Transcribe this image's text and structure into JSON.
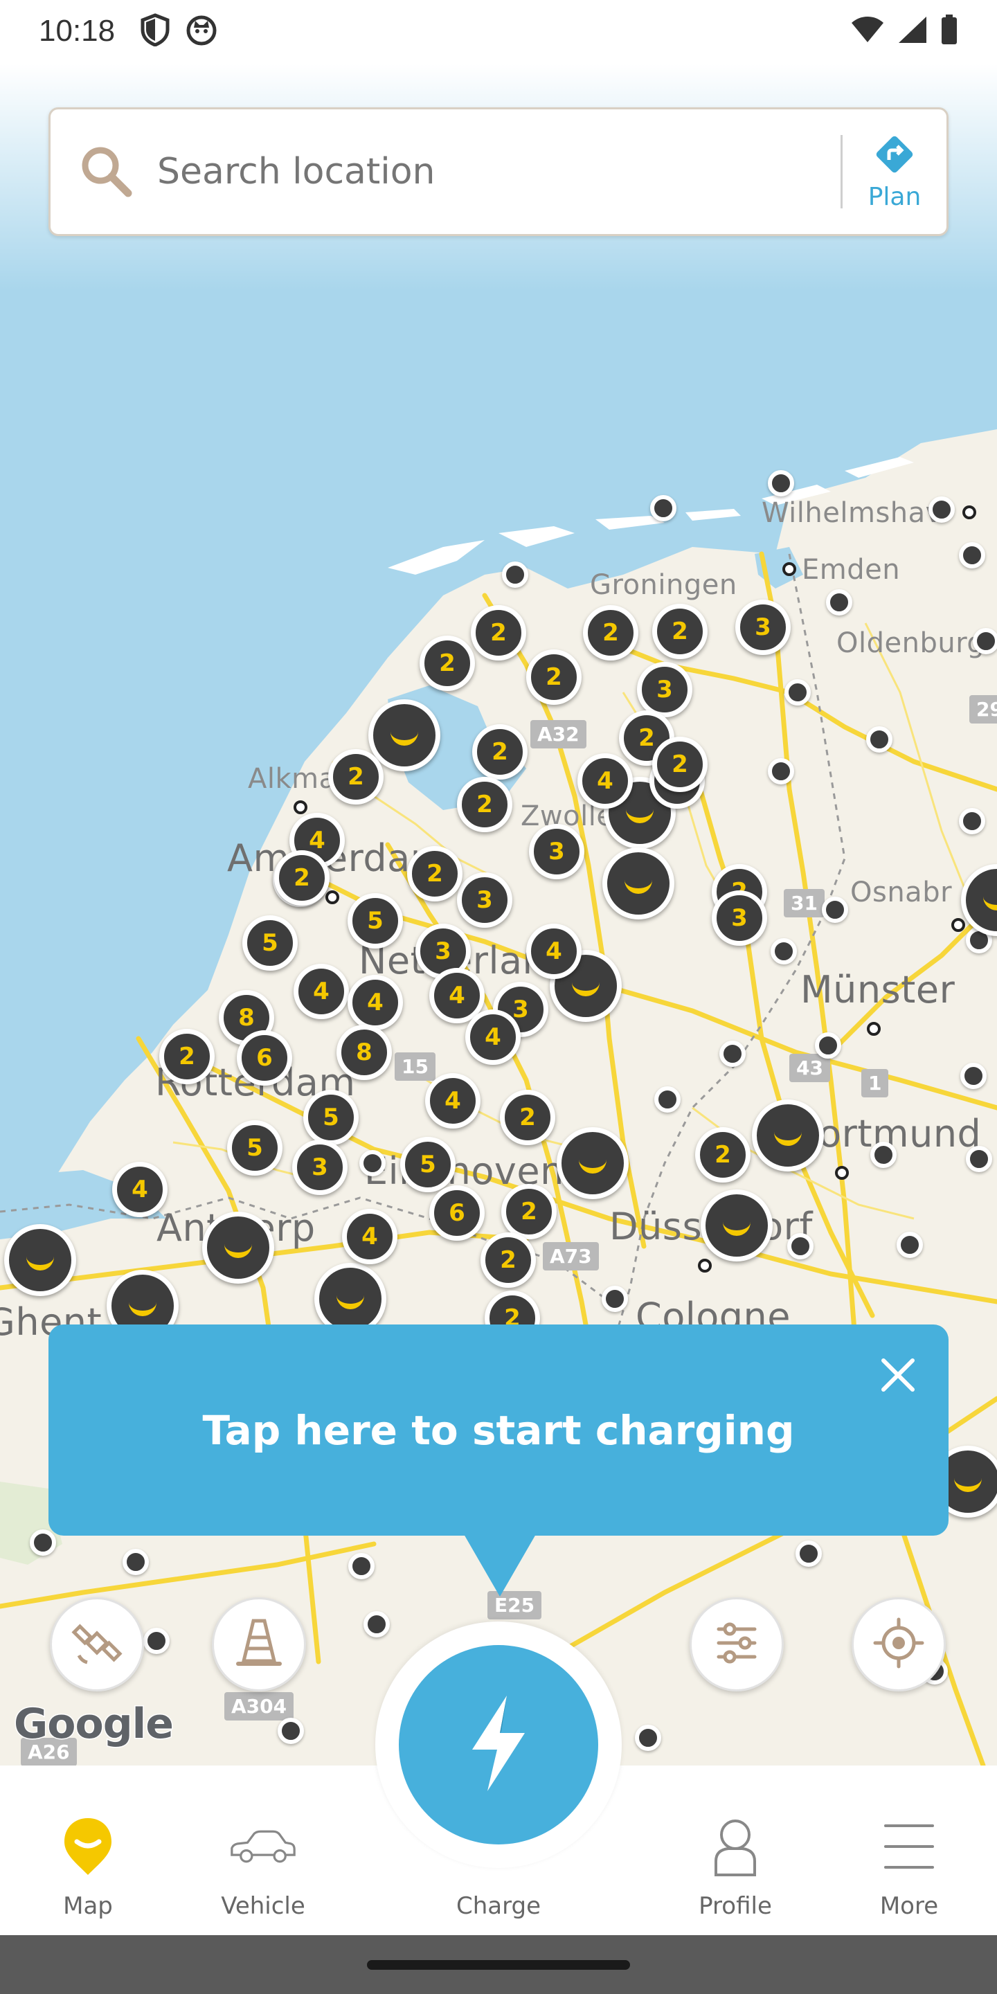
{
  "status_bar": {
    "time": "10:18",
    "icons": [
      "shield-icon",
      "cat-face-icon"
    ],
    "right_icons": [
      "wifi-icon",
      "cellular-signal-icon",
      "battery-icon"
    ]
  },
  "search": {
    "placeholder": "Search location",
    "plan_label": "Plan"
  },
  "map": {
    "labels": {
      "wilhelmshaven": "Wilhelmshav",
      "emden": "Emden",
      "groningen": "Groningen",
      "oldenburg": "Oldenburg",
      "alkmaar": "Alkma",
      "amsterdam": "Amsterdam",
      "zwolle": "Zwolle",
      "osnabruck": "Osnabr",
      "netherlands": "Netherlands",
      "munster": "Münster",
      "rotterdam": "Rotterdam",
      "dortmund": "Dortmund",
      "eindhoven": "Eindhoven",
      "antwerp": "Antwerp",
      "dusseldorf": "Düsseldorf",
      "cologne": "Cologne",
      "ghent": "Ghent"
    },
    "road_shields": {
      "a32": "A32",
      "a31": "31",
      "a43": "43",
      "a1": "1",
      "a15": "15",
      "a73": "A73",
      "e25": "E25",
      "a304": "A304",
      "a26": "A26",
      "a29": "29"
    },
    "cluster_counts": [
      "2",
      "2",
      "2",
      "3",
      "2",
      "2",
      "3",
      "2",
      "2",
      "4",
      "2",
      "2",
      "4",
      "2",
      "3",
      "2",
      "3",
      "5",
      "2",
      "5",
      "3",
      "4",
      "4",
      "4",
      "4",
      "3",
      "8",
      "2",
      "6",
      "8",
      "4",
      "4",
      "2",
      "5",
      "5",
      "3",
      "5",
      "2",
      "3",
      "4",
      "6",
      "2",
      "2",
      "4",
      "2",
      "2",
      "2",
      "2"
    ]
  },
  "tooltip": {
    "text": "Tap here to start charging"
  },
  "nav": {
    "map": "Map",
    "vehicle": "Vehicle",
    "charge": "Charge",
    "profile": "Profile",
    "more": "More"
  },
  "google_logo": "Google",
  "colors": {
    "accent_blue": "#47b0dc",
    "pin_yellow": "#f5c800",
    "pin_dark": "#3d3d3d",
    "water": "#a9d6ec",
    "land": "#f4f1e8"
  }
}
